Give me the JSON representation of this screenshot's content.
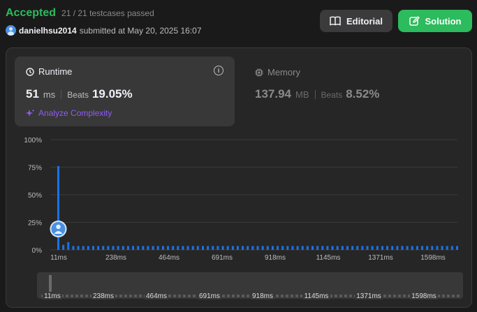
{
  "status": {
    "label": "Accepted",
    "testcases": "21 / 21 testcases passed"
  },
  "submission": {
    "username": "danielhsu2014",
    "submitted_text": "submitted at May 20, 2025 16:07"
  },
  "buttons": {
    "editorial": "Editorial",
    "solution": "Solution"
  },
  "runtime": {
    "title": "Runtime",
    "value": "51",
    "unit": "ms",
    "beats_label": "Beats",
    "beats_value": "19.05%",
    "analyze_label": "Analyze Complexity",
    "icon": "clock-icon"
  },
  "memory": {
    "title": "Memory",
    "value": "137.94",
    "unit": "MB",
    "beats_label": "Beats",
    "beats_value": "8.52%",
    "icon": "chip-icon"
  },
  "colors": {
    "accent_green": "#2cbb5d",
    "bar_blue": "#1a73e8",
    "analyze_purple": "#8f5cf5",
    "card_bg": "#383838",
    "panel_bg": "#262626"
  },
  "chart_data": {
    "type": "bar",
    "y_ticks": [
      "100%",
      "75%",
      "50%",
      "25%",
      "0%"
    ],
    "ylim": [
      0,
      100
    ],
    "x_tick_labels": [
      "11ms",
      "238ms",
      "464ms",
      "691ms",
      "918ms",
      "1145ms",
      "1371ms",
      "1598ms"
    ],
    "values": [
      76,
      4.5,
      7,
      3.5,
      3.5,
      3.5,
      3.5,
      3.5,
      3.5,
      3.5,
      3.5,
      3.5,
      3.5,
      3.5,
      3.5,
      3.5,
      3.5,
      3.5,
      3.5,
      3.5,
      3.5,
      3.5,
      3.5,
      3.5,
      3.5,
      3.5,
      3.5,
      3.5,
      3.5,
      3.5,
      3.5,
      3.5,
      3.5,
      3.5,
      3.5,
      3.5,
      3.5,
      3.5,
      3.5,
      3.5,
      3.5,
      3.5,
      3.5,
      3.5,
      3.5,
      3.5,
      3.5,
      3.5,
      3.5,
      3.5,
      3.5,
      3.5,
      3.5,
      3.5,
      3.5,
      3.5,
      3.5,
      3.5,
      3.5,
      3.5,
      3.5,
      3.5,
      3.5,
      3.5,
      3.5,
      3.5,
      3.5,
      3.5,
      3.5,
      3.5,
      3.5,
      3.5,
      3.5,
      3.5,
      3.5,
      3.5,
      3.5,
      3.5,
      3.5,
      3.5,
      3.5
    ],
    "user_marker_value": 19,
    "grid": true
  }
}
